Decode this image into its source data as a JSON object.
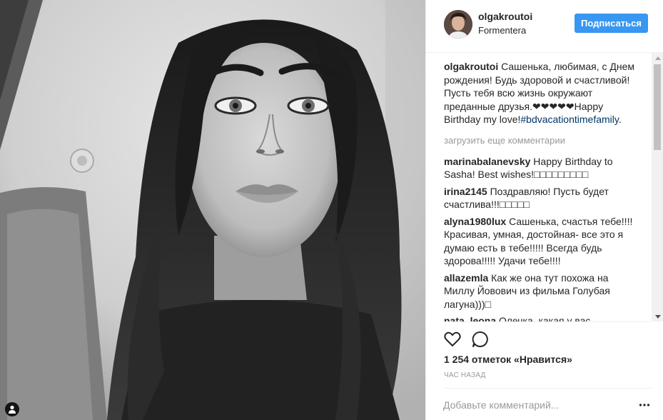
{
  "post": {
    "username": "olgakroutoi",
    "location": "Formentera",
    "follow_label": "Подписаться",
    "load_more": "загрузить еще комментарии",
    "likes": "1 254 отметок «Нравится»",
    "time": "ЧАС НАЗАД",
    "add_comment_placeholder": "Добавьте комментарий..."
  },
  "caption": {
    "username": "olgakroutoi",
    "text": "Сашенька, любимая, с Днем рождения! Будь здоровой и счастливой! Пусть тебя всю жизнь окружают преданные друзья.❤❤❤❤❤Happy Birthday my love!",
    "hashtag": "#bdvacationtimefamily",
    "tail": "."
  },
  "comments": [
    {
      "username": "marinabalanevsky",
      "text": "Happy Birthday to Sasha! Best wishes!□□□□□□□□□"
    },
    {
      "username": "irina2145",
      "text": "Поздравляю! Пусть будет счастлива!!!□□□□□"
    },
    {
      "username": "alyna1980lux",
      "text": "Сашенька, счастья тебе!!!! Красивая, умная, достойная- все это я думаю есть в тебе!!!!! Всегда будь здорова!!!!! Удачи тебе!!!!"
    },
    {
      "username": "allazemla",
      "text": "Как же она тут похожа на Миллу Йовович из фильма Голубая лагуна)))□"
    },
    {
      "username": "nata_leona",
      "text": "Олечка, какая у вас красивая,"
    }
  ],
  "icons": {
    "heart": "heart-icon",
    "comment": "comment-icon",
    "more": "more-options-icon",
    "user_tag": "user-tag-icon"
  },
  "colors": {
    "follow_button": "#3897f0",
    "hashtag": "#003569",
    "muted": "#999999",
    "text": "#262626"
  }
}
